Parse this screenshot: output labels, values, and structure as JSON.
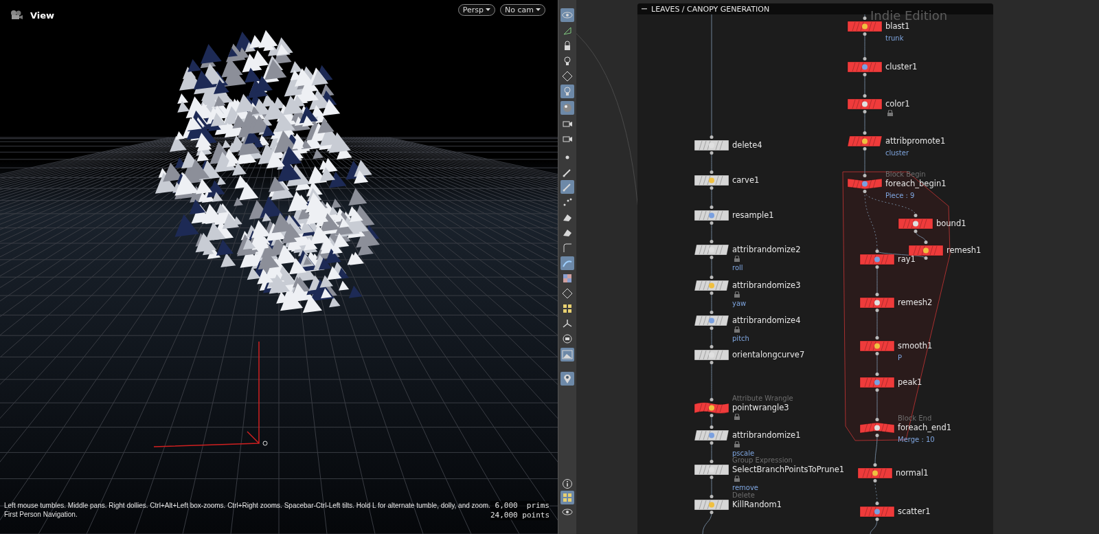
{
  "viewport": {
    "title": "View",
    "camera_buttons": [
      {
        "label": "Persp"
      },
      {
        "label": "No cam"
      }
    ],
    "status_lines": [
      "Left mouse tumbles. Middle pans. Right dollies. Ctrl+Alt+Left box-zooms. Ctrl+Right zooms. Spacebar-Ctrl-Left tilts. Hold L for alternate tumble, dolly, and zoom.",
      "First Person Navigation."
    ],
    "stats": [
      "6,000  prims",
      "24,000 points"
    ]
  },
  "toolbar": [
    {
      "on": true
    },
    {
      "on": false
    },
    {
      "on": false
    },
    {
      "on": false
    },
    {
      "on": false
    },
    {
      "on": true
    },
    {
      "on": true
    },
    {
      "on": false
    },
    {
      "on": false
    },
    {
      "on": false
    },
    {
      "on": false
    },
    {
      "on": true
    },
    {
      "on": false
    },
    {
      "on": false
    },
    {
      "on": false
    },
    {
      "on": false
    },
    {
      "on": true
    },
    {
      "on": false
    },
    {
      "on": false
    },
    {
      "on": false
    },
    {
      "on": false
    },
    {
      "on": false
    },
    {
      "on": true
    },
    {
      "on": true
    },
    {
      "on": false
    },
    {
      "on": true
    },
    {
      "on": false
    }
  ],
  "network": {
    "title": "LEAVES / CANOPY GENERATION",
    "watermark": "Indie Edition",
    "nodes": [
      {
        "name": "blast1",
        "kind": "rect",
        "color": "#ef3b3b",
        "locked": false,
        "sub": "trunk"
      },
      {
        "name": "cluster1",
        "kind": "rect",
        "color": "#ef3b3b",
        "locked": false
      },
      {
        "name": "color1",
        "kind": "rect",
        "color": "#ef3b3b",
        "locked": true
      },
      {
        "name": "attribpromote1",
        "kind": "slant",
        "color": "#ef3b3b",
        "locked": false,
        "sub": "cluster"
      },
      {
        "name": "foreach_begin1",
        "kind": "begin",
        "color": "#ef3b3b",
        "locked": false,
        "type_label": "Block Begin",
        "sub": "Piece : 9"
      },
      {
        "name": "bound1",
        "kind": "rect",
        "color": "#ef3b3b",
        "locked": false
      },
      {
        "name": "remesh1",
        "kind": "rect",
        "color": "#ef3b3b",
        "locked": false
      },
      {
        "name": "ray1",
        "kind": "rect",
        "color": "#ef3b3b",
        "locked": false
      },
      {
        "name": "remesh2",
        "kind": "rect",
        "color": "#ef3b3b",
        "locked": false
      },
      {
        "name": "smooth1",
        "kind": "rect",
        "color": "#ef3b3b",
        "locked": false,
        "sub": "P"
      },
      {
        "name": "peak1",
        "kind": "rect",
        "color": "#ef3b3b",
        "locked": false
      },
      {
        "name": "foreach_end1",
        "kind": "end",
        "color": "#ef3b3b",
        "locked": false,
        "type_label": "Block End",
        "sub": "Merge : 10"
      },
      {
        "name": "normal1",
        "kind": "rect",
        "color": "#ef3b3b",
        "locked": false
      },
      {
        "name": "scatter1",
        "kind": "rect",
        "color": "#ef3b3b",
        "locked": false
      },
      {
        "name": "delete4",
        "kind": "rect",
        "color": "#d6d6d6",
        "locked": false
      },
      {
        "name": "carve1",
        "kind": "rect",
        "color": "#d6d6d6",
        "locked": false
      },
      {
        "name": "resample1",
        "kind": "rect",
        "color": "#d6d6d6",
        "locked": false
      },
      {
        "name": "attribrandomize2",
        "kind": "slant",
        "color": "#d6d6d6",
        "locked": true,
        "sub": "roll"
      },
      {
        "name": "attribrandomize3",
        "kind": "slant",
        "color": "#d6d6d6",
        "locked": true,
        "sub": "yaw"
      },
      {
        "name": "attribrandomize4",
        "kind": "slant",
        "color": "#d6d6d6",
        "locked": true,
        "sub": "pitch"
      },
      {
        "name": "orientalongcurve7",
        "kind": "rect",
        "color": "#d6d6d6",
        "locked": false
      },
      {
        "name": "pointwrangle3",
        "kind": "wave",
        "color": "#ef3b3b",
        "locked": true,
        "type_label": "Attribute Wrangle"
      },
      {
        "name": "attribrandomize1",
        "kind": "slant",
        "color": "#d6d6d6",
        "locked": true,
        "sub": "pscale"
      },
      {
        "name": "SelectBranchPointsToPrune1",
        "kind": "rect",
        "color": "#d6d6d6",
        "locked": true,
        "type_label": "Group Expression",
        "sub": "remove"
      },
      {
        "name": "KillRandom1",
        "kind": "rect",
        "color": "#d6d6d6",
        "locked": false,
        "type_label": "Delete"
      }
    ]
  }
}
